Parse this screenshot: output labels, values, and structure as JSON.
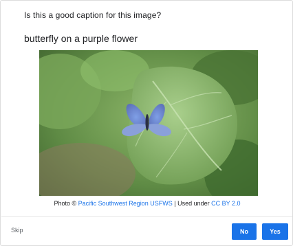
{
  "prompt": {
    "question": "Is this a good caption for this image?",
    "caption": "butterfly on a purple flower"
  },
  "attribution": {
    "prefix": "Photo © ",
    "author": "Pacific Southwest Region USFWS",
    "separator": " | Used under ",
    "license": "CC BY 2.0"
  },
  "actions": {
    "skip_label": "Skip",
    "no_label": "No",
    "yes_label": "Yes"
  },
  "colors": {
    "accent": "#1a73e8",
    "text": "#202124",
    "muted": "#5f6368"
  }
}
